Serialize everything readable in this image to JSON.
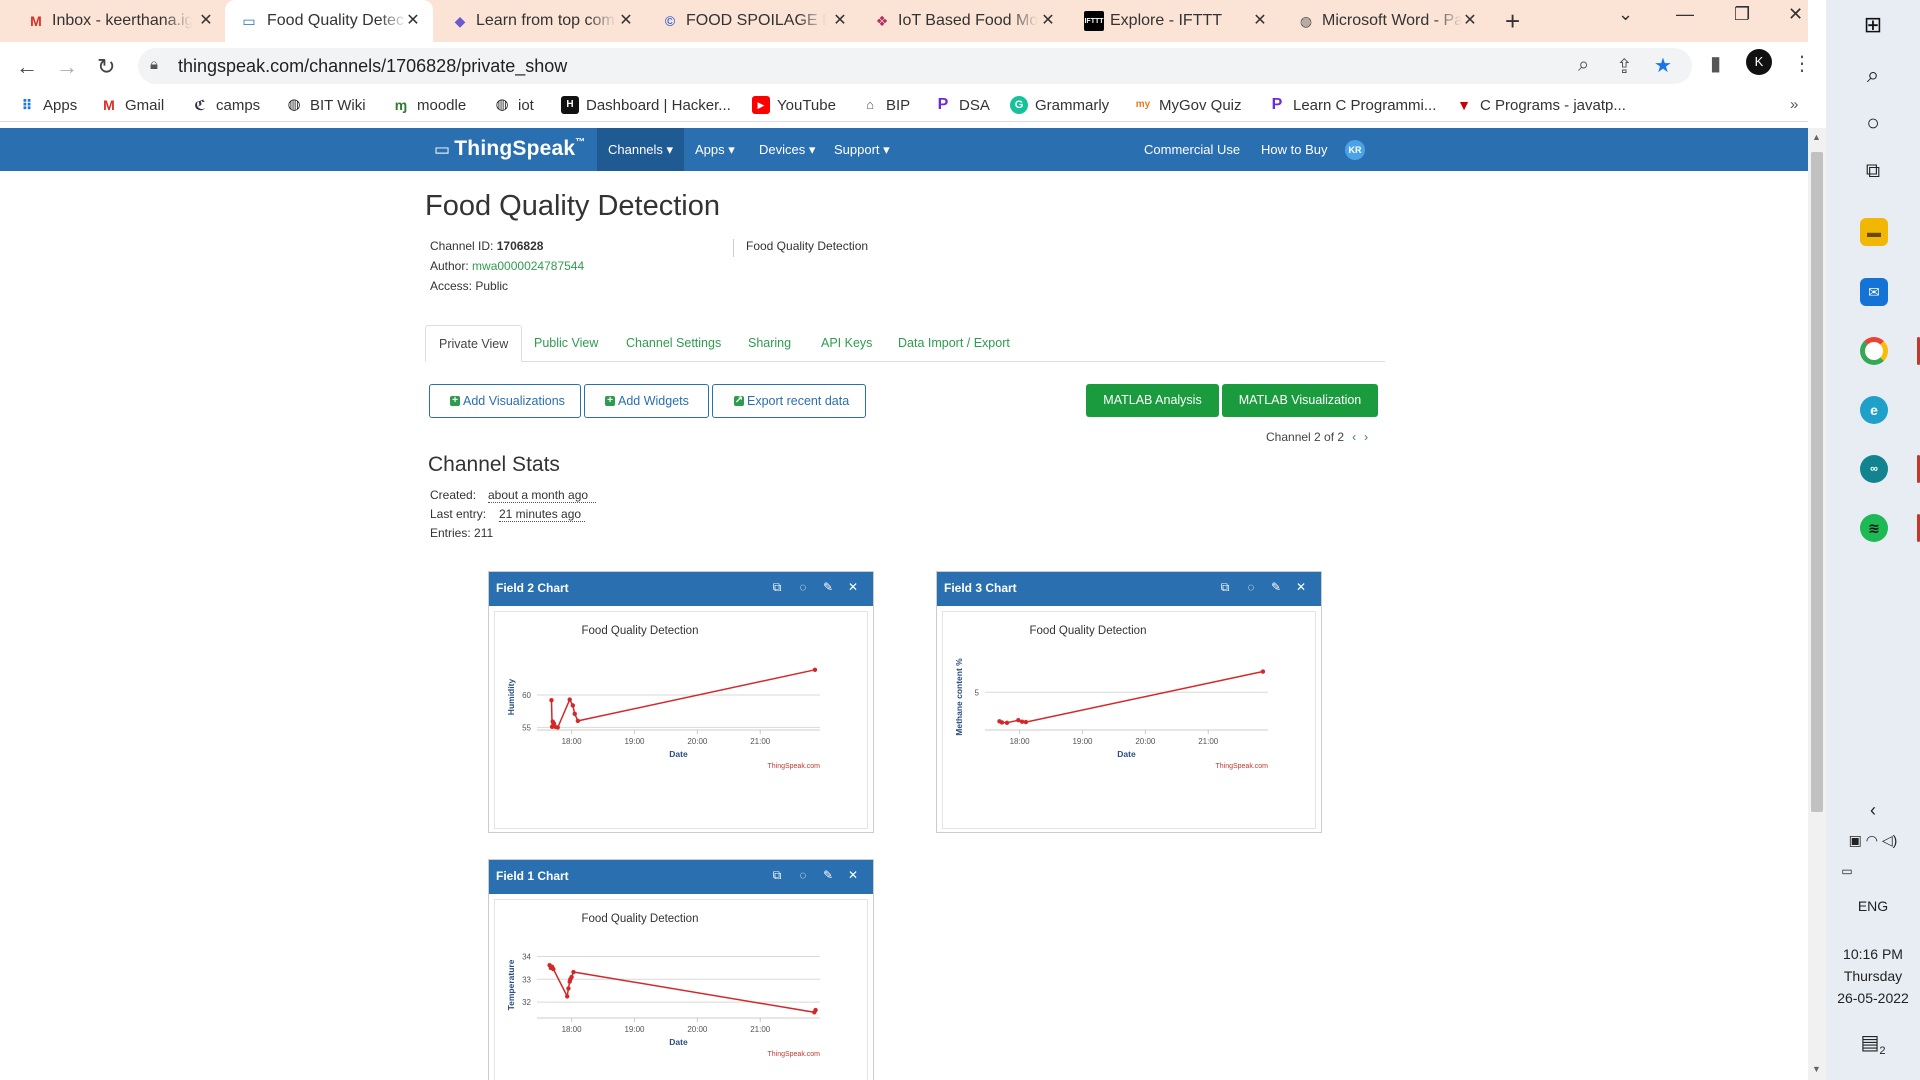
{
  "browser": {
    "tabs": [
      {
        "title": "Inbox - keerthana.ig",
        "icon": "gmail-icon"
      },
      {
        "title": "Food Quality Detec",
        "icon": "thingspeak-icon"
      },
      {
        "title": "Learn from top com",
        "icon": "gem-icon"
      },
      {
        "title": "FOOD SPOILAGE DE",
        "icon": "site-icon"
      },
      {
        "title": "IoT Based Food Mo",
        "icon": "site-icon"
      },
      {
        "title": "Explore - IFTTT",
        "icon": "ifttt-icon"
      },
      {
        "title": "Microsoft Word - Pa",
        "icon": "globe-icon"
      }
    ],
    "url": "thingspeak.com/channels/1706828/private_show",
    "bookmarks": [
      {
        "label": "Apps",
        "icon": "apps-grid-icon"
      },
      {
        "label": "Gmail",
        "icon": "gmail-icon"
      },
      {
        "label": "camps",
        "icon": "camps-icon"
      },
      {
        "label": "BIT Wiki",
        "icon": "globe-icon"
      },
      {
        "label": "moodle",
        "icon": "moodle-icon"
      },
      {
        "label": "iot",
        "icon": "globe-icon"
      },
      {
        "label": "Dashboard | Hacker...",
        "icon": "hackerrank-icon"
      },
      {
        "label": "YouTube",
        "icon": "youtube-icon"
      },
      {
        "label": "BIP",
        "icon": "bip-icon"
      },
      {
        "label": "DSA",
        "icon": "dsa-icon"
      },
      {
        "label": "Grammarly",
        "icon": "grammarly-icon"
      },
      {
        "label": "MyGov Quiz",
        "icon": "mygov-icon"
      },
      {
        "label": "Learn C Programmi...",
        "icon": "learn-c-icon"
      },
      {
        "label": "C Programs - javatp...",
        "icon": "javatpoint-icon"
      }
    ]
  },
  "nav": {
    "logo": "ThingSpeak",
    "logo_tm": "™",
    "menus": [
      "Channels ▾",
      "Apps ▾",
      "Devices ▾",
      "Support ▾"
    ],
    "commercial": "Commercial Use",
    "how_to_buy": "How to Buy",
    "avatar": "KR"
  },
  "channel": {
    "title": "Food Quality Detection",
    "id_label": "Channel ID:",
    "id": "1706828",
    "author_label": "Author:",
    "author": "mwa0000024787544",
    "access": "Access: Public",
    "description": "Food Quality Detection",
    "tabs": [
      "Private View",
      "Public View",
      "Channel Settings",
      "Sharing",
      "API Keys",
      "Data Import / Export"
    ],
    "buttons": {
      "add_visualizations": "Add Visualizations",
      "add_widgets": "Add Widgets",
      "export": "Export recent data",
      "matlab_analysis": "MATLAB Analysis",
      "matlab_visualization": "MATLAB Visualization"
    },
    "channel_nav": "Channel 2 of 2",
    "stats_title": "Channel Stats",
    "created_label": "Created:",
    "created": "about a month ago",
    "last_entry_label": "Last entry:",
    "last_entry": "21 minutes ago",
    "entries": "Entries: 211"
  },
  "chart_data": [
    {
      "panel_title": "Field 2 Chart",
      "type": "line",
      "title": "Food Quality Detection",
      "xlabel": "Date",
      "ylabel": "Humidity",
      "watermark": "ThingSpeak.com",
      "xticks": [
        "18:00",
        "19:00",
        "20:00",
        "21:00"
      ],
      "yticks": [
        55,
        60
      ],
      "xlim": [
        17.45,
        21.95
      ],
      "ylim": [
        54.6,
        64.8
      ],
      "color": "#d62728",
      "points": [
        {
          "x": 17.68,
          "y": 59.2
        },
        {
          "x": 17.69,
          "y": 55.1
        },
        {
          "x": 17.7,
          "y": 55.9
        },
        {
          "x": 17.72,
          "y": 55.6
        },
        {
          "x": 17.74,
          "y": 55.1
        },
        {
          "x": 17.78,
          "y": 55.0
        },
        {
          "x": 17.97,
          "y": 59.3
        },
        {
          "x": 18.02,
          "y": 58.4
        },
        {
          "x": 18.05,
          "y": 57.1
        },
        {
          "x": 18.1,
          "y": 56.0
        },
        {
          "x": 21.87,
          "y": 63.9
        }
      ]
    },
    {
      "panel_title": "Field 3 Chart",
      "type": "line",
      "title": "Food Quality Detection",
      "xlabel": "Date",
      "ylabel": "Methane content %",
      "watermark": "ThingSpeak.com",
      "xticks": [
        "18:00",
        "19:00",
        "20:00",
        "21:00"
      ],
      "yticks": [
        5
      ],
      "xlim": [
        17.45,
        21.95
      ],
      "ylim": [
        4.0,
        5.75
      ],
      "color": "#d62728",
      "points": [
        {
          "x": 17.68,
          "y": 4.23
        },
        {
          "x": 17.72,
          "y": 4.2
        },
        {
          "x": 17.8,
          "y": 4.19
        },
        {
          "x": 17.98,
          "y": 4.26
        },
        {
          "x": 18.04,
          "y": 4.22
        },
        {
          "x": 18.1,
          "y": 4.21
        },
        {
          "x": 21.87,
          "y": 5.55
        }
      ]
    },
    {
      "panel_title": "Field 1 Chart",
      "type": "line",
      "title": "Food Quality Detection",
      "xlabel": "Date",
      "ylabel": "Temperature",
      "watermark": "ThingSpeak.com",
      "xticks": [
        "18:00",
        "19:00",
        "20:00",
        "21:00"
      ],
      "yticks": [
        32,
        33,
        34
      ],
      "xlim": [
        17.45,
        21.95
      ],
      "ylim": [
        31.3,
        34.2
      ],
      "color": "#d62728",
      "points": [
        {
          "x": 17.65,
          "y": 33.62
        },
        {
          "x": 17.67,
          "y": 33.5
        },
        {
          "x": 17.69,
          "y": 33.55
        },
        {
          "x": 17.71,
          "y": 33.45
        },
        {
          "x": 17.93,
          "y": 32.25
        },
        {
          "x": 17.95,
          "y": 32.6
        },
        {
          "x": 17.97,
          "y": 32.9
        },
        {
          "x": 17.98,
          "y": 33.0
        },
        {
          "x": 18.0,
          "y": 33.1
        },
        {
          "x": 18.03,
          "y": 33.32
        },
        {
          "x": 21.86,
          "y": 31.55
        },
        {
          "x": 21.88,
          "y": 31.65
        }
      ]
    }
  ],
  "taskbar": {
    "language": "ENG",
    "time": "10:16 PM",
    "day": "Thursday",
    "date": "26-05-2022",
    "notifications": "2",
    "apps": [
      "windows-start-icon",
      "search-icon",
      "cortana-icon",
      "task-view-icon",
      "file-explorer-icon",
      "mail-icon",
      "chrome-icon",
      "edge-icon",
      "arduino-icon",
      "spotify-icon"
    ]
  }
}
